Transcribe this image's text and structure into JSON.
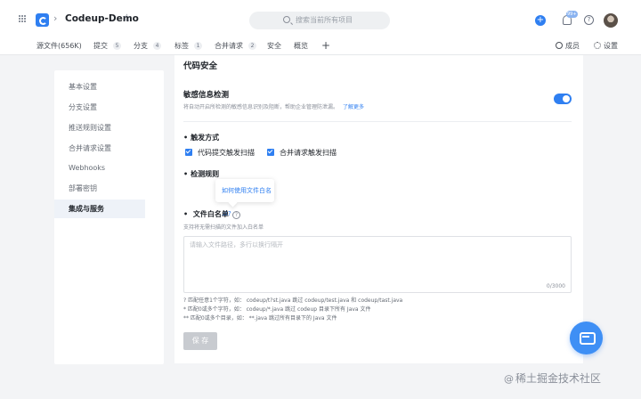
{
  "header": {
    "repo_name": "Codeup-Demo",
    "search_placeholder": "搜索当前所有项目",
    "notification_count": "99+"
  },
  "tabs": [
    {
      "label": "源文件(656K)",
      "count": ""
    },
    {
      "label": "提交",
      "count": "5"
    },
    {
      "label": "分支",
      "count": "4"
    },
    {
      "label": "标签",
      "count": "1"
    },
    {
      "label": "合并请求",
      "count": "2"
    },
    {
      "label": "安全",
      "count": ""
    },
    {
      "label": "概览",
      "count": ""
    }
  ],
  "tab_actions": {
    "members": "成员",
    "settings": "设置"
  },
  "sidebar": {
    "items": [
      {
        "label": "基本设置"
      },
      {
        "label": "分支设置"
      },
      {
        "label": "推送规则设置"
      },
      {
        "label": "合并请求设置"
      },
      {
        "label": "Webhooks"
      },
      {
        "label": "部署密钥"
      },
      {
        "label": "集成与服务"
      }
    ],
    "active_index": 6
  },
  "main": {
    "title": "代码安全",
    "sensitive_title": "敏感信息检测",
    "sensitive_desc": "将自动开启所检测的敏感信息识别及阻断，帮助企业管理防泄漏。",
    "learn_more": "了解更多",
    "trigger_label": "触发方式",
    "trigger_options": [
      "代码提交触发扫描",
      "合并请求触发扫描"
    ],
    "detect_label": "检测规则",
    "tooltip": "如何使用文件白名单?",
    "whitelist_label": "文件白名单",
    "whitelist_desc": "支持将无需扫描的文件加入白名单",
    "textarea_placeholder": "请输入文件路径，多行以换行隔开",
    "char_count": "0/3000",
    "hints": [
      "?   匹配任意1个字符，如： codeup/t?st.java 跳过 codeup/test.java 和 codeup/tast.java",
      "*   匹配0或多个字符，如： codeup/*.java 跳过 codeup 目录下所有 Java 文件",
      "**  匹配0或多个目录，如： **.java 跳过所有目录下的 Java 文件"
    ],
    "save_label": "保 存"
  },
  "watermark": "稀土掘金技术社区"
}
